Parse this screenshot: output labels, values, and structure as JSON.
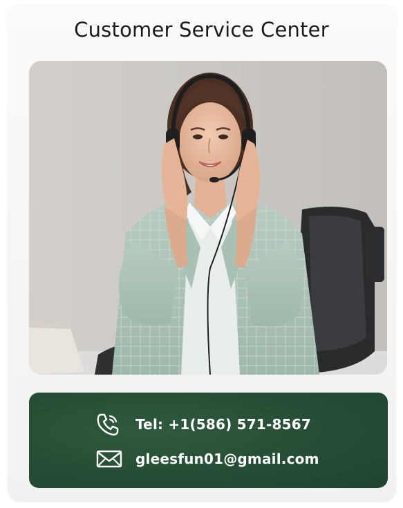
{
  "title": "Customer Service Center",
  "photo": {
    "subject": "customer-service-agent-photo"
  },
  "contact": {
    "phone": "Tel: +1(586) 571-8567",
    "email": "gleesfun01@gmail.com",
    "phone_icon": "phone-icon",
    "email_icon": "envelope-icon"
  },
  "colors": {
    "panel": "#264d35",
    "text_dark": "#1b1b1b",
    "text_light": "#ffffff"
  }
}
